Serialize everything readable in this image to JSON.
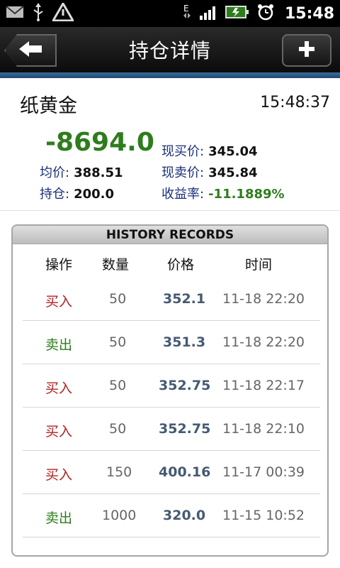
{
  "status_bar": {
    "time": "15:48",
    "icons": [
      "gmail-icon",
      "usb-icon",
      "warning-icon",
      "network-e-icon",
      "signal-icon",
      "battery-charging-icon",
      "alarm-icon"
    ]
  },
  "titlebar": {
    "title": "持仓详情",
    "back_icon": "back-arrow-icon",
    "add_icon": "plus-icon"
  },
  "header": {
    "name": "纸黄金",
    "time": "15:48:37",
    "pnl_value": "-8694.0",
    "avg_price_label": "均价:",
    "avg_price": "388.51",
    "position_label": "持仓:",
    "position": "200.0",
    "buy_price_label": "现买价:",
    "buy_price": "345.04",
    "sell_price_label": "现卖价:",
    "sell_price": "345.84",
    "yield_label": "收益率:",
    "yield": "-11.1889%"
  },
  "history": {
    "title": "HISTORY RECORDS",
    "columns": [
      "操作",
      "数量",
      "价格",
      "时间"
    ],
    "rows": [
      {
        "op": "买入",
        "qty": "50",
        "price": "352.1",
        "time": "11-18 22:20",
        "type": "buy"
      },
      {
        "op": "卖出",
        "qty": "50",
        "price": "351.3",
        "time": "11-18 22:20",
        "type": "sell"
      },
      {
        "op": "买入",
        "qty": "50",
        "price": "352.75",
        "time": "11-18 22:17",
        "type": "buy"
      },
      {
        "op": "买入",
        "qty": "50",
        "price": "352.75",
        "time": "11-18 22:10",
        "type": "buy"
      },
      {
        "op": "买入",
        "qty": "150",
        "price": "400.16",
        "time": "11-17 00:39",
        "type": "buy"
      },
      {
        "op": "卖出",
        "qty": "1000",
        "price": "320.0",
        "time": "11-15 10:52",
        "type": "sell"
      }
    ]
  },
  "colors": {
    "positive_green": "#2e7d1d",
    "buy_red": "#b22222",
    "label_blue": "#1a2f7a",
    "price_slate": "#455a74",
    "accent_blue": "#1f4872"
  }
}
